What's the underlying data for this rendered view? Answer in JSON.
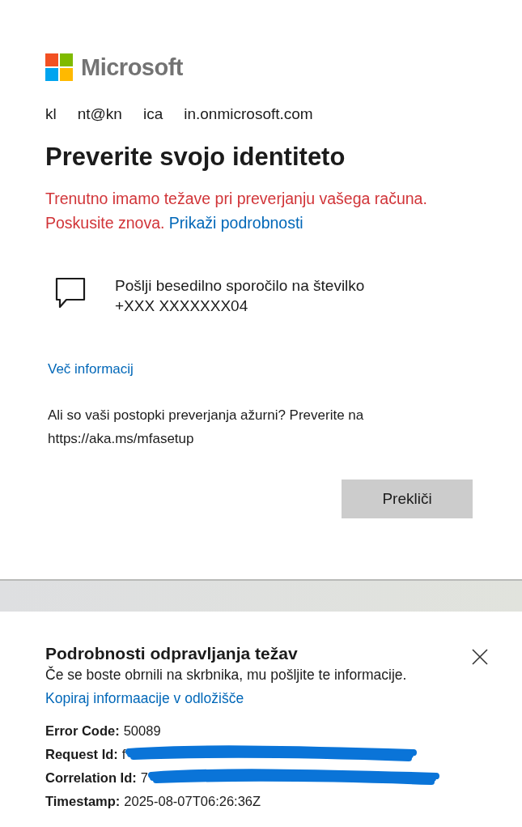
{
  "logo": {
    "name": "Microsoft"
  },
  "account": {
    "fragments": [
      "kl",
      "nt@kn",
      "ica",
      "in.onmicrosoft.com"
    ]
  },
  "title": "Preverite svojo identiteto",
  "error": {
    "message": "Trenutno imamo težave pri preverjanju vašega računa. Poskusite znova.",
    "link": "Prikaži podrobnosti"
  },
  "option": {
    "line_1": "Pošlji besedilno sporočilo na številko",
    "line_2": "+XXX XXXXXXX04"
  },
  "more_info": "Več informacij",
  "notice": {
    "text": "Ali so vaši postopki preverjanja ažurni? Preverite na",
    "url": "https://aka.ms/mfasetup"
  },
  "buttons": [
    "Prekliči"
  ],
  "details": {
    "title": "Podrobnosti odpravljanja težav",
    "subtitle": "Če se boste obrnili na skrbnika, mu pošljite te informacije.",
    "copy_link": "Kopiraj informaacije v odložišče",
    "fields": [
      {
        "label": "Error Code:",
        "value": "50089",
        "redacted": false
      },
      {
        "label": "Request Id:",
        "value": "f",
        "redacted": true
      },
      {
        "label": "Correlation Id:",
        "value": "7",
        "redacted": true
      },
      {
        "label": "Timestamp:",
        "value": "2025-08-07T06:26:36Z",
        "redacted": false
      }
    ]
  }
}
